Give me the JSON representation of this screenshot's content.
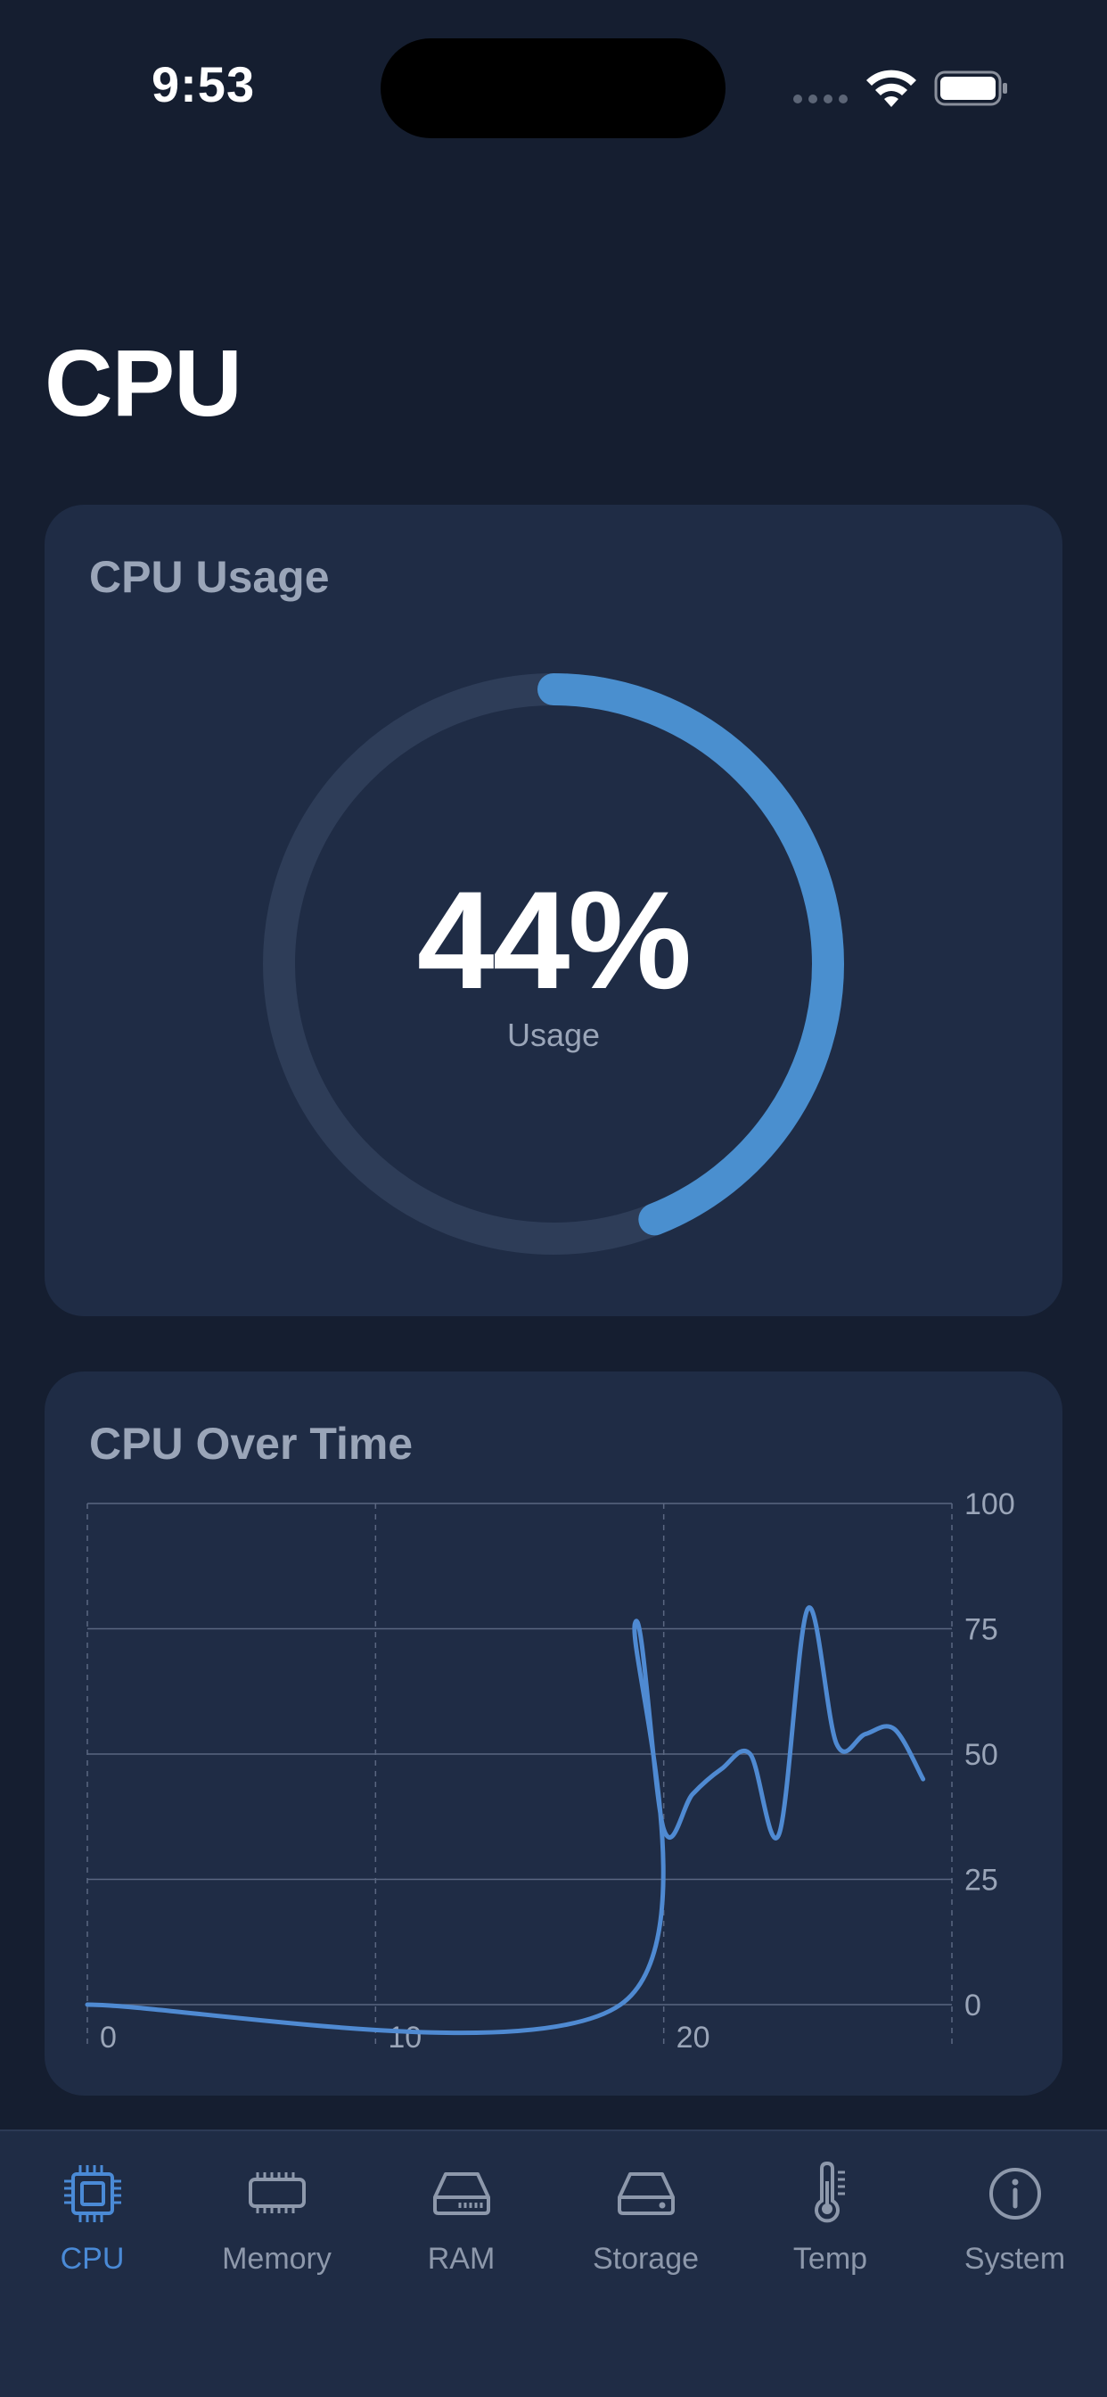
{
  "status_bar": {
    "time": "9:53"
  },
  "page": {
    "title": "CPU"
  },
  "usage_card": {
    "title": "CPU Usage",
    "value_text": "44%",
    "value": 44,
    "caption": "Usage",
    "ring_color": "#4a8fcf",
    "track_color": "#2e3d58"
  },
  "chart_card": {
    "title": "CPU Over Time",
    "chart_data": {
      "type": "line",
      "x": [
        0,
        18.5,
        19,
        20,
        21,
        22,
        23,
        24,
        25,
        26,
        27,
        28,
        29
      ],
      "series": [
        {
          "values": [
            0,
            0,
            76,
            35,
            42,
            47,
            50,
            34,
            79,
            52,
            54,
            55,
            45
          ]
        }
      ],
      "ylim": [
        0,
        100
      ],
      "xlim": [
        0,
        30
      ],
      "y_ticks": [
        "100",
        "75",
        "50",
        "25",
        "0"
      ],
      "x_ticks": [
        "0",
        "10",
        "20"
      ],
      "y_axis_side": "right",
      "grid": true,
      "line_color": "#4f8ad2"
    }
  },
  "tabbar": {
    "active": "cpu",
    "items": [
      {
        "id": "cpu",
        "label": "CPU",
        "icon": "cpu-chip-icon"
      },
      {
        "id": "memory",
        "label": "Memory",
        "icon": "memory-module-icon"
      },
      {
        "id": "ram",
        "label": "RAM",
        "icon": "ram-drive-icon"
      },
      {
        "id": "storage",
        "label": "Storage",
        "icon": "internal-drive-icon"
      },
      {
        "id": "temp",
        "label": "Temp",
        "icon": "thermometer-icon"
      },
      {
        "id": "system",
        "label": "System",
        "icon": "info-circle-icon"
      }
    ]
  }
}
